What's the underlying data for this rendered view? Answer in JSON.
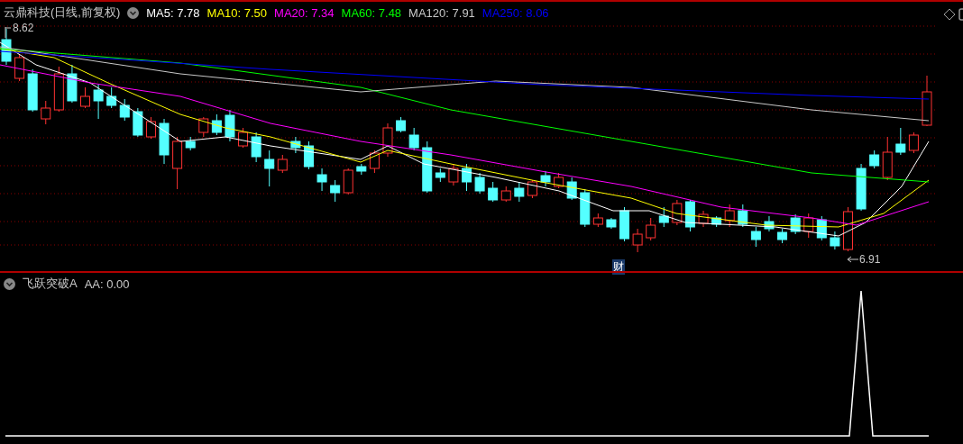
{
  "price_panel": {
    "title": "云鼎科技(日线,前复权)",
    "moving_averages": [
      {
        "label": "MA5:",
        "value": "7.78",
        "color": "#ffffff"
      },
      {
        "label": "MA10:",
        "value": "7.50",
        "color": "#ffff00"
      },
      {
        "label": "MA20:",
        "value": "7.34",
        "color": "#ff00ff"
      },
      {
        "label": "MA60:",
        "value": "7.48",
        "color": "#00ff00"
      },
      {
        "label": "MA120:",
        "value": "7.91",
        "color": "#c8c8c8"
      },
      {
        "label": "MA250:",
        "value": "8.06",
        "color": "#0000ff"
      }
    ],
    "high_label": "8.62",
    "low_label": "6.91",
    "event_marker": "财"
  },
  "indicator_panel": {
    "title": "飞跃突破A",
    "reading": "AA: 0.00"
  }
}
